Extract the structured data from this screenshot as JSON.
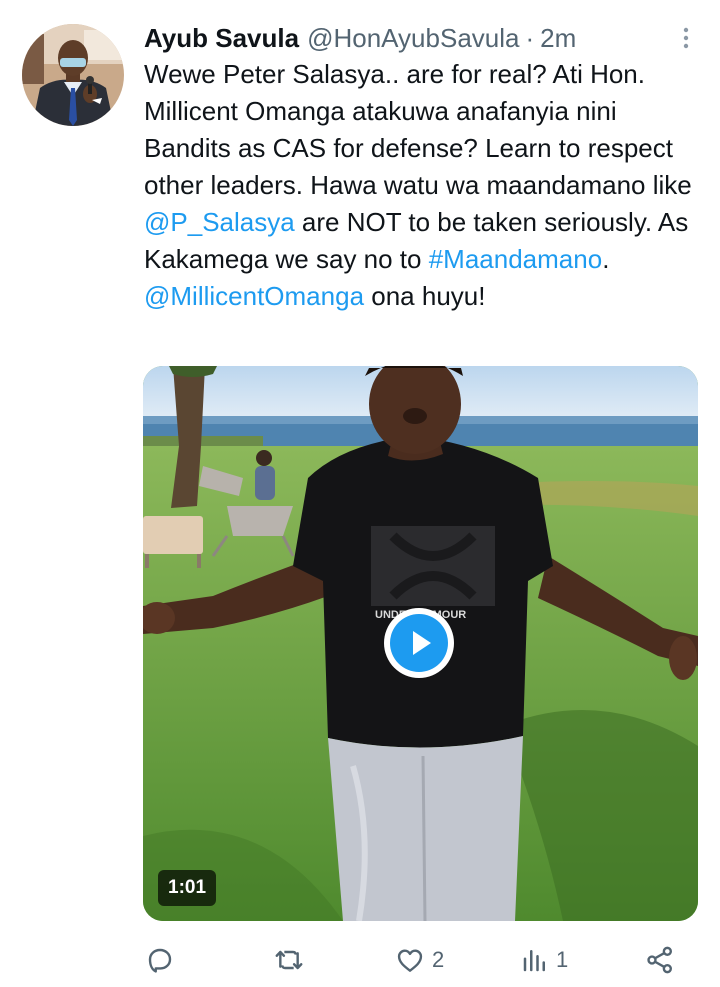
{
  "tweet": {
    "author_name": "Ayub Savula",
    "handle": "@HonAyubSavula",
    "separator": "·",
    "time": "2m",
    "text_parts": [
      "Wewe Peter Salasya.. are for real? Ati Hon. Millicent Omanga atakuwa anafanyia nini Bandits as CAS for defense? Learn to respect other leaders.  Hawa watu wa maandamano like ",
      "@P_Salasya",
      " are NOT to be taken seriously. As Kakamega we say no to ",
      "#Maandamano",
      ".",
      "@MillicentOmanga",
      " ona huyu!"
    ]
  },
  "media": {
    "type": "video",
    "duration": "1:01",
    "shirt_text": "UNDER ARMOUR"
  },
  "actions": {
    "reply_count": "",
    "retweet_count": "",
    "like_count": "2",
    "views_count": "1"
  },
  "icons": {
    "more": "more-vertical-icon",
    "reply": "reply-icon",
    "retweet": "retweet-icon",
    "like": "heart-icon",
    "views": "views-icon",
    "share": "share-icon",
    "play": "play-icon"
  },
  "colors": {
    "link": "#1d9bf0",
    "secondary_text": "#536471",
    "primary_text": "#0f1419",
    "play_button": "#1d9bf0"
  }
}
